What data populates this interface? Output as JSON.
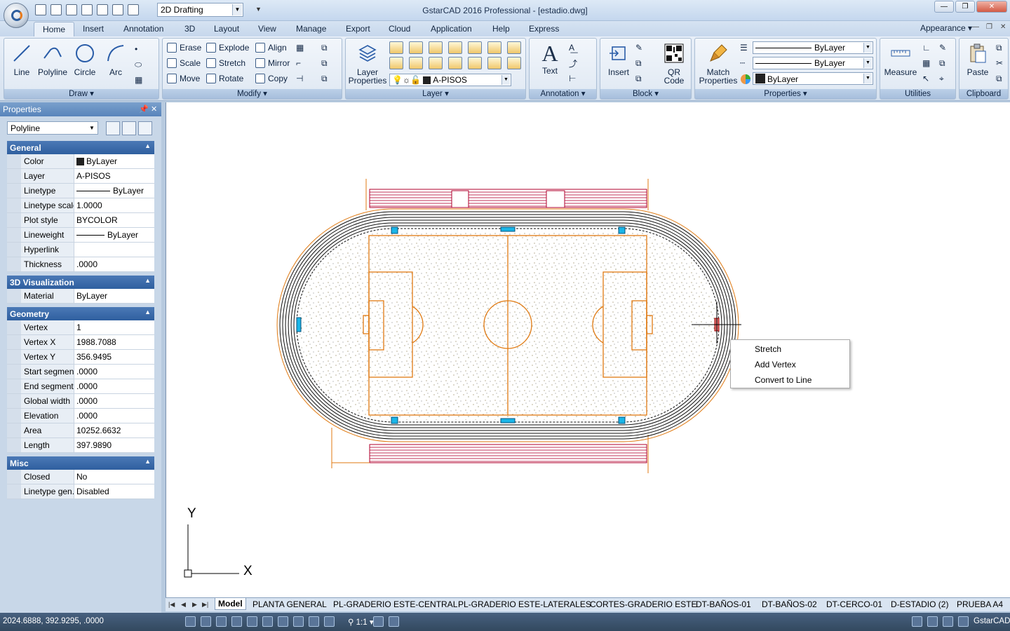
{
  "window": {
    "title": "GstarCAD 2016 Professional - [estadio.dwg]",
    "workspace": "2D Drafting"
  },
  "ribbon_tabs": [
    "Home",
    "Insert",
    "Annotation",
    "3D",
    "Layout",
    "View",
    "Manage",
    "Export",
    "Cloud",
    "Application",
    "Help",
    "Express"
  ],
  "appearance_label": "Appearance",
  "draw": {
    "title": "Draw",
    "line": "Line",
    "polyline": "Polyline",
    "circle": "Circle",
    "arc": "Arc"
  },
  "modify": {
    "title": "Modify",
    "erase": "Erase",
    "explode": "Explode",
    "align": "Align",
    "scale": "Scale",
    "stretch": "Stretch",
    "mirror": "Mirror",
    "move": "Move",
    "rotate": "Rotate",
    "copy": "Copy"
  },
  "layer": {
    "title": "Layer",
    "properties_label": "Layer Properties",
    "current": "A-PISOS"
  },
  "annotation": {
    "title": "Annotation",
    "text": "Text"
  },
  "block": {
    "title": "Block",
    "insert": "Insert",
    "qr": "QR Code"
  },
  "properties_panel": {
    "title": "Properties",
    "match": "Match Properties",
    "linetype": "ByLayer",
    "lineweight": "ByLayer",
    "color": "ByLayer"
  },
  "utilities": {
    "title": "Utilities",
    "measure": "Measure"
  },
  "clipboard": {
    "title": "Clipboard",
    "paste": "Paste"
  },
  "palette": {
    "title": "Properties",
    "object_type": "Polyline",
    "general": {
      "title": "General",
      "rows": [
        {
          "k": "Color",
          "v": "ByLayer"
        },
        {
          "k": "Layer",
          "v": "A-PISOS"
        },
        {
          "k": "Linetype",
          "v": "ByLayer"
        },
        {
          "k": "Linetype scale",
          "v": "1.0000"
        },
        {
          "k": "Plot style",
          "v": "BYCOLOR"
        },
        {
          "k": "Lineweight",
          "v": "ByLayer"
        },
        {
          "k": "Hyperlink",
          "v": ""
        },
        {
          "k": "Thickness",
          "v": ".0000"
        }
      ]
    },
    "viz": {
      "title": "3D Visualization",
      "rows": [
        {
          "k": "Material",
          "v": "ByLayer"
        }
      ]
    },
    "geometry": {
      "title": "Geometry",
      "rows": [
        {
          "k": "Vertex",
          "v": "1"
        },
        {
          "k": "Vertex X",
          "v": "1988.7088"
        },
        {
          "k": "Vertex Y",
          "v": "356.9495"
        },
        {
          "k": "Start segmen...",
          "v": ".0000"
        },
        {
          "k": "End segment...",
          "v": ".0000"
        },
        {
          "k": "Global width",
          "v": ".0000"
        },
        {
          "k": "Elevation",
          "v": ".0000"
        },
        {
          "k": "Area",
          "v": "10252.6632"
        },
        {
          "k": "Length",
          "v": "397.9890"
        }
      ]
    },
    "misc": {
      "title": "Misc",
      "rows": [
        {
          "k": "Closed",
          "v": "No"
        },
        {
          "k": "Linetype gen...",
          "v": "Disabled"
        }
      ]
    }
  },
  "context_menu": [
    "Stretch",
    "Add Vertex",
    "Convert to Line"
  ],
  "ucs": {
    "x": "X",
    "y": "Y"
  },
  "layout_tabs": [
    "Model",
    "PLANTA GENERAL",
    "PL-GRADERIO ESTE-CENTRAL",
    "PL-GRADERIO ESTE-LATERALES",
    "CORTES-GRADERIO ESTE",
    "DT-BAÑOS-01",
    "DT-BAÑOS-02",
    "DT-CERCO-01",
    "D-ESTADIO (2)",
    "PRUEBA A4"
  ],
  "status": {
    "coords": "2024.6888, 392.9295, .0000",
    "scale": "1:1",
    "app": "GstarCAD"
  },
  "colors": {
    "accent": "#2f5f9f",
    "drawing_orange": "#e07a12",
    "bleacher_red": "#b0002e",
    "grip": "#1ab6e8"
  }
}
